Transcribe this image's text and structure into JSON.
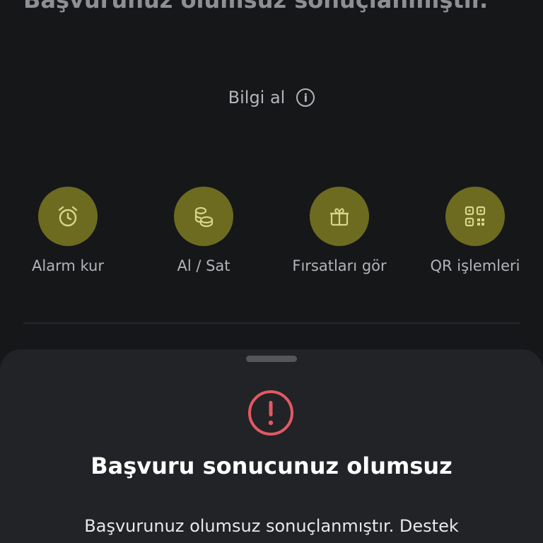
{
  "heading": {
    "text": "Başvurunuz olumsuz sonuçlanmıştır."
  },
  "info": {
    "label": "Bilgi al",
    "icon": "info-icon"
  },
  "actions": [
    {
      "label": "Alarm kur",
      "icon": "alarm-clock-icon"
    },
    {
      "label": "Al / Sat",
      "icon": "coins-icon"
    },
    {
      "label": "Fırsatları gör",
      "icon": "gift-icon"
    },
    {
      "label": "QR işlemleri",
      "icon": "qr-code-icon"
    }
  ],
  "colors": {
    "background": "#161719",
    "accent_circle": "#6c6b20",
    "icon_color": "#d7d68a",
    "sheet": "#222326",
    "error": "#e15a64"
  },
  "sheet": {
    "icon": "error-icon",
    "title": "Başvuru sonucunuz olumsuz",
    "message": "Başvurunuz olumsuz sonuçlanmıştır. Destek"
  }
}
